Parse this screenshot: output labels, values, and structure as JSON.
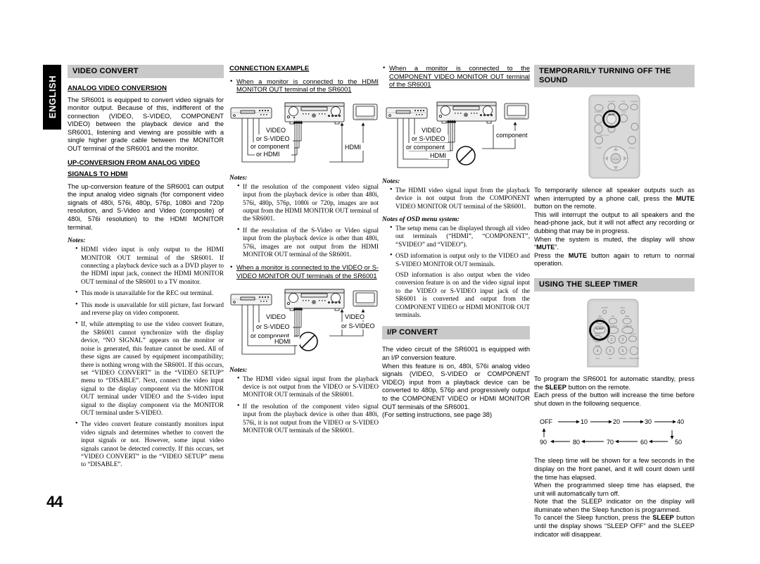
{
  "page": {
    "number": "44",
    "language_tab": "ENGLISH"
  },
  "column1": {
    "section_title": "VIDEO CONVERT",
    "sub1_title": "ANALOG VIDEO CONVERSION",
    "sub1_body": "The SR6001 is equipped to convert video signals for monitor output. Because of this, indifferent of the connection (VIDEO, S-VIDEO, COMPONENT VIDEO) between the playback device and the SR6001, listening and viewing are possible with a single higher grade cable between the MONITOR OUT terminal of the SR6001 and the monitor.",
    "sub2_title_line1": "UP-CONVERSION FROM ANALOG VIDEO",
    "sub2_title_line2": "SIGNALS TO HDMI",
    "sub2_body": "The up-conversion feature of the SR6001 can output the input analog video signals (for component video signals of 480i, 576i, 480p, 576p, 1080i and 720p resolution, and S-Video and Video (composite) of 480i, 576i resolution) to the HDMI MONITOR terminal.",
    "notes_label": "Notes:",
    "notes": [
      "HDMI video input is only output to the HDMI MONITOR OUT terminal of the SR6001. If connecting a playback device such as a DVD player to the HDMI input jack, connect the HDMI MONITOR OUT terminal of the SR6001 to a TV monitor.",
      "This mode is unavailable for the REC out terminal.",
      "This mode is unavailable for still picture, fast forward and reverse play on video component.",
      "If, while attempting to use the video convert feature, the SR6001 cannot synchronize with the display device, “NO SIGNAL” appears on the monitor or noise is generated, this feature cannot be used. All of these signs are caused by equipment incompatibility; there is nothing wrong with the SR6001. If this occurs, set “VIDEO CONVERT” in the “VIDEO SETUP” menu to “DISABLE”. Next, connect the video input signal to the display component via the MONITOR OUT terminal under VIDEO and the S-video input signal to the display component via the MONITOR OUT terminal under S-VIDEO.",
      "The video convert feature constantly monitors input video signals and determines whether to convert the input signals or not. However, some input video signals cannot be detected correctly. If this occurs, set “VIDEO CONVERT” in the “VIDEO SETUP” menu to “DISABLE”."
    ]
  },
  "column2": {
    "section_title": "CONNECTION EXAMPLE",
    "caption1": "When a monitor is connected to the HDMI MONITOR OUT terminal of the SR6001",
    "diagram1_labels": [
      "VIDEO",
      "or S-VIDEO",
      "or component",
      "or HDMI",
      "HDMI"
    ],
    "notes_label": "Notes:",
    "notes1": [
      "If the resolution of the component video signal input from the playback device is other than 480i, 576i, 480p, 576p, 1080i or 720p, images are not output from the HDMI MONITOR OUT terminal of the SR6001.",
      "If the resolution of the S-Video or Video signal input from the playback device is other than 480i, 576i, images are not output from the HDMI MONITOR OUT terminal of the SR6001."
    ],
    "caption2": "When a monitor is connected to the VIDEO or S-VIDEO MONITOR OUT terminals of the SR6001",
    "diagram2_labels": [
      "VIDEO",
      "or S-VIDEO",
      "or component",
      "HDMI",
      "VIDEO",
      "or S-VIDEO"
    ],
    "notes2_label": "Notes:",
    "notes2": [
      "The HDMI video signal input from the playback device is not output from the VIDEO or S-VIDEO MONITOR OUT terminals of the SR6001.",
      "If the resolution of the component video signal input from the playback device is other than 480i, 576i, it is not output from the VIDEO or S-VIDEO MONITOR OUT terminals of the SR6001."
    ]
  },
  "column3": {
    "caption1": "When a monitor is connected to the COMPONENT VIDEO MONITOR OUT terminal of the SR6001",
    "diagram_labels": [
      "VIDEO",
      "or S-VIDEO",
      "or component",
      "HDMI",
      "component"
    ],
    "notes_label": "Notes:",
    "notes": [
      "The HDMI video signal input from the playback device is not output from the COMPONENT VIDEO MONITOR OUT terminal of the SR6001."
    ],
    "osd_notes_label": "Notes of OSD menu system:",
    "osd_notes": [
      "The setup menu can be displayed through all video out terminals (“HDMI”, “COMPONENT”, “SVIDEO” and “VIDEO”).",
      "OSD information is output only to the VIDEO and S-VIDEO MONITOR OUT terminals."
    ],
    "osd_extra": "OSD information is also output when the video conversion feature is on and the video signal input to the VIDEO or S-VIDEO input jack of the SR6001 is converted and output from the COMPONENT VIDEO or HDMI MONITOR OUT terminals.",
    "ip_section_title": "I/P CONVERT",
    "ip_body1": "The video circuit of the SR6001 is equipped with an I/P conversion feature.",
    "ip_body2": "When this feature is on, 480i, 576i analog video signals (VIDEO, S-VIDEO or COMPONENT VIDEO) input from a playback device can be converted to 480p, 576p and progressively output to the COMPONENT VIDEO or HDMI MONITOR OUT terminals of the SR6001.",
    "ip_body3": "(For setting instructions, see page 38)"
  },
  "column4": {
    "mute_section_title": "TEMPORARILY TURNING OFF  THE SOUND",
    "mute_p1_a": "To temporarily silence all speaker outputs such as when interrupted by a phone call, press the ",
    "mute_p1_b": "MUTE",
    "mute_p1_c": " button on the remote.",
    "mute_p2": "This will interrupt the output to all speakers and the head-phone jack, but it will not affect any recording or dubbing that may be in progress.",
    "mute_p3_a": "When the system is muted, the display will show “",
    "mute_p3_b": "MUTE",
    "mute_p3_c": "”.",
    "mute_p4_a": "Press the ",
    "mute_p4_b": "MUTE",
    "mute_p4_c": " button again to return to normal operation.",
    "sleep_section_title": "USING THE SLEEP TIMER",
    "sleep_p1_a": "To program the SR6001 for automatic standby, press the ",
    "sleep_p1_b": "SLEEP",
    "sleep_p1_c": " button on the remote.",
    "sleep_p2": "Each press of the button will increase the time before shut down in the following sequence.",
    "sequence_row1": [
      "OFF",
      "10",
      "20",
      "30",
      "40"
    ],
    "sequence_row2": [
      "90",
      "80",
      "70",
      "60",
      "50"
    ],
    "sleep_p3": "The sleep time will be shown for a few seconds in the display on the front panel, and it will count down until the time has elapsed.",
    "sleep_p4": "When the programmed sleep time has elapsed, the unit will automatically turn off.",
    "sleep_p5": "Note that the SLEEP indicator on the display will illuminate when the Sleep function is programmed.",
    "sleep_p6_a": "To cancel the Sleep function, press the ",
    "sleep_p6_b": "SLEEP",
    "sleep_p6_c": " button until the display shows “SLEEP OFF” and the SLEEP indicator will disappear.",
    "remote_mute_label": "MUTE",
    "remote_sleep_label": "SLEEP"
  }
}
